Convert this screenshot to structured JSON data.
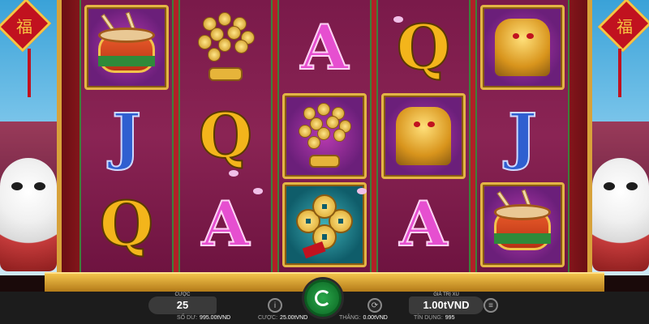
{
  "game": {
    "lantern_glyph": "福",
    "reels": [
      [
        {
          "type": "drum",
          "framed": true,
          "style": "purple"
        },
        {
          "type": "letter",
          "value": "J"
        },
        {
          "type": "letter",
          "value": "Q"
        }
      ],
      [
        {
          "type": "money-tree",
          "framed": false
        },
        {
          "type": "letter",
          "value": "Q"
        },
        {
          "type": "letter",
          "value": "A"
        }
      ],
      [
        {
          "type": "letter",
          "value": "A"
        },
        {
          "type": "money-tree",
          "framed": true,
          "style": "purple"
        },
        {
          "type": "coins-charm",
          "framed": true,
          "style": "teal"
        }
      ],
      [
        {
          "type": "letter",
          "value": "Q"
        },
        {
          "type": "lion-statue",
          "framed": true,
          "style": "purple"
        },
        {
          "type": "letter",
          "value": "A"
        }
      ],
      [
        {
          "type": "lion-statue",
          "framed": true,
          "style": "purple"
        },
        {
          "type": "letter",
          "value": "J"
        },
        {
          "type": "drum",
          "framed": true,
          "style": "purple"
        }
      ]
    ]
  },
  "controls": {
    "bet_label": "CƯỢC",
    "bet_value": "25",
    "coin_value_label": "GIÁ TRỊ XU",
    "coin_value": "1.00tVND",
    "info_icon": "info-icon",
    "autoplay_icon": "autoplay-icon",
    "spin_icon": "spin-icon",
    "stack_icon": "coin-stack-icon"
  },
  "status": {
    "balance_label": "SỐ DƯ:",
    "balance_value": "995.00tVND",
    "bet_label": "CƯỢC:",
    "bet_value": "25.00tVND",
    "win_label": "THẮNG:",
    "win_value": "0.00tVND",
    "credit_label": "TÍN DỤNG:",
    "credit_value": "995"
  },
  "colors": {
    "frame_red": "#b22027",
    "gold": "#f2c24b",
    "reel_purple": "#7a1a4a",
    "spin_green": "#2aa84a"
  }
}
